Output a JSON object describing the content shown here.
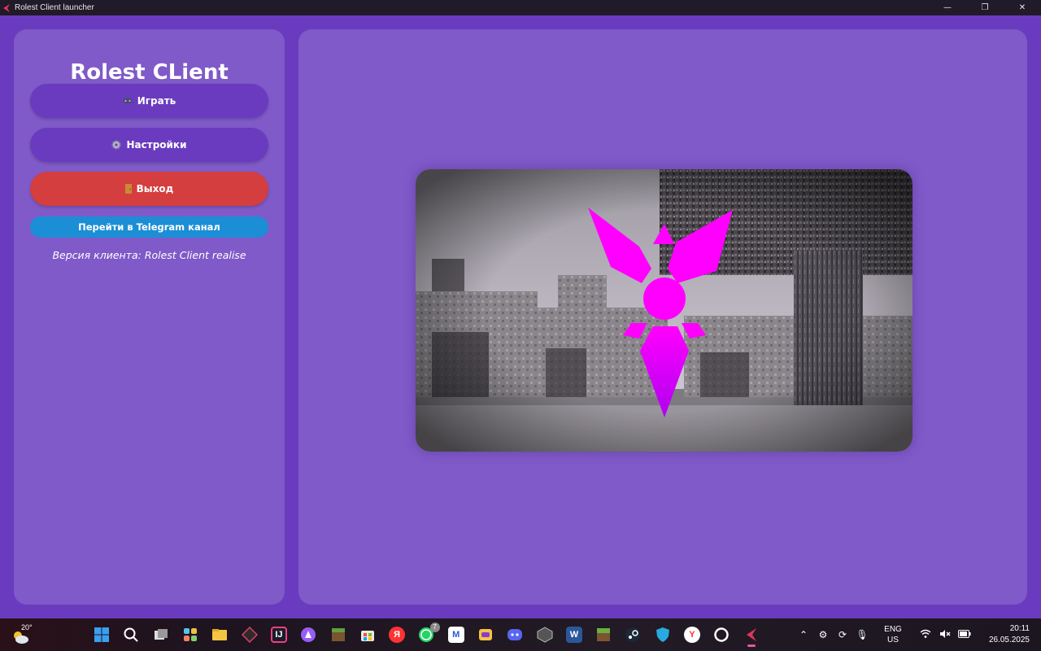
{
  "window": {
    "title": "Rolest Client launcher",
    "controls": {
      "minimize": "—",
      "restore": "❐",
      "close": "✕"
    }
  },
  "sidebar": {
    "app_title": "Rolest CLient",
    "buttons": {
      "play": {
        "icon": "gamepad-icon",
        "label": "Играть"
      },
      "settings": {
        "icon": "gear-icon",
        "label": "Настройки"
      },
      "exit": {
        "icon": "door-icon",
        "label": "Выход"
      },
      "telegram": {
        "label": "Перейти в Telegram канал"
      }
    },
    "version_text": "Версия клиента: Rolest Client realise"
  },
  "main": {
    "preview": {
      "description_icon": "rolest-logo-icon"
    }
  },
  "taskbar": {
    "weather": {
      "temp": "20°",
      "icon": "weather-cloud-sun-icon"
    },
    "apps": [
      {
        "name": "start",
        "glyph": ""
      },
      {
        "name": "search",
        "glyph": ""
      },
      {
        "name": "task-view",
        "glyph": ""
      },
      {
        "name": "widgets",
        "glyph": ""
      },
      {
        "name": "file-explorer",
        "glyph": ""
      },
      {
        "name": "app-1",
        "glyph": ""
      },
      {
        "name": "intellij",
        "glyph": "IJ"
      },
      {
        "name": "alice",
        "glyph": ""
      },
      {
        "name": "minecraft",
        "glyph": ""
      },
      {
        "name": "store",
        "glyph": ""
      },
      {
        "name": "yandex",
        "glyph": "Я"
      },
      {
        "name": "whatsapp",
        "glyph": "",
        "badge": "7"
      },
      {
        "name": "app-m",
        "glyph": "M"
      },
      {
        "name": "game-app",
        "glyph": ""
      },
      {
        "name": "discord",
        "glyph": ""
      },
      {
        "name": "world-of-tanks",
        "glyph": ""
      },
      {
        "name": "word",
        "glyph": "W"
      },
      {
        "name": "minecraft-2",
        "glyph": ""
      },
      {
        "name": "steam",
        "glyph": ""
      },
      {
        "name": "shield-app",
        "glyph": ""
      },
      {
        "name": "yandex-browser",
        "glyph": "Y"
      },
      {
        "name": "opera-gx",
        "glyph": ""
      },
      {
        "name": "rolest-launcher",
        "glyph": ""
      }
    ],
    "tray": {
      "lang_line1": "ENG",
      "lang_line2": "US",
      "time": "20:11",
      "date": "26.05.2025"
    }
  },
  "colors": {
    "background": "#6a3bbf",
    "panel": "#7f5ac8",
    "button": "#6a3bbf",
    "exit": "#d43e3e",
    "telegram": "#1c8ed6",
    "logo": "#ff00ff"
  }
}
